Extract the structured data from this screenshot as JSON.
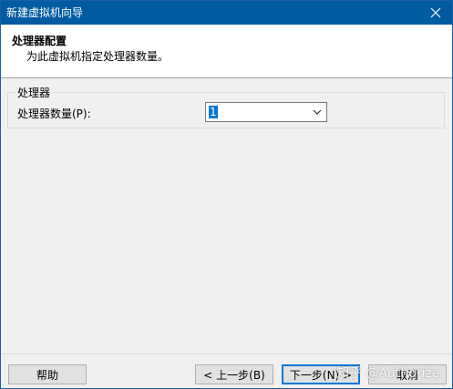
{
  "window": {
    "title": "新建虚拟机向导",
    "titlebar_color": "#005ba1"
  },
  "header": {
    "title": "处理器配置",
    "subtitle": "为此虚拟机指定处理器数量。"
  },
  "processor": {
    "group_label": "处理器",
    "count_label": "处理器数量(P):",
    "count_value": "1"
  },
  "buttons": {
    "help": "帮助",
    "prev": "< 上一步(B)",
    "next": "下一步(N) >",
    "cancel": "取消"
  },
  "watermark": "知乎 @Authorize",
  "icons": {
    "close": "close-icon",
    "dropdown": "chevron-down-icon"
  }
}
